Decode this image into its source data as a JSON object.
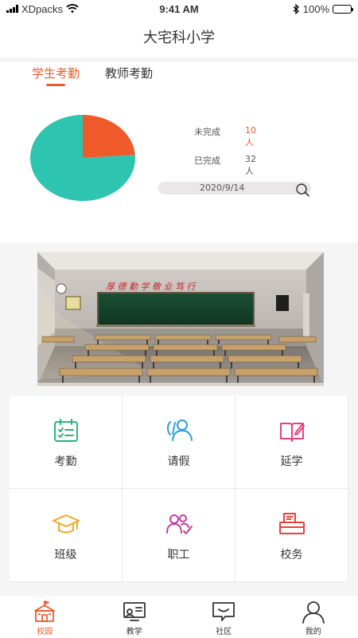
{
  "status_bar": {
    "carrier": "XDpacks",
    "time": "9:41 AM",
    "battery_text": "100%",
    "battery_level": 1.0
  },
  "header": {
    "title": "大宅科小学"
  },
  "attendance": {
    "tabs": [
      {
        "label": "学生考勤",
        "active": true
      },
      {
        "label": "教师考勤",
        "active": false
      }
    ],
    "stats": [
      {
        "label": "未完成",
        "value": "10人"
      },
      {
        "label": "已完成",
        "value": "32人"
      }
    ],
    "date": "2020/9/14",
    "colors": {
      "incomplete": "#ef5a2a",
      "complete": "#2dc4b0",
      "accent": "#ef5a2a"
    }
  },
  "chart_data": {
    "type": "pie",
    "labels": [
      "未完成",
      "已完成"
    ],
    "values": [
      10,
      32
    ],
    "colors": [
      "#ef5a2a",
      "#2dc4b0"
    ]
  },
  "menu": {
    "items": [
      {
        "label": "考勤",
        "icon": "attendance-icon",
        "color": "#2bb673"
      },
      {
        "label": "请假",
        "icon": "leave-icon",
        "color": "#2a9fd8"
      },
      {
        "label": "延学",
        "icon": "extended-study-icon",
        "color": "#e8417f"
      },
      {
        "label": "班级",
        "icon": "class-icon",
        "color": "#f5a623"
      },
      {
        "label": "职工",
        "icon": "staff-icon",
        "color": "#c63aa4"
      },
      {
        "label": "校务",
        "icon": "school-affairs-icon",
        "color": "#e8423a"
      }
    ]
  },
  "tabbar": {
    "items": [
      {
        "label": "校园",
        "icon": "campus-icon",
        "active": true
      },
      {
        "label": "教学",
        "icon": "teaching-icon",
        "active": false
      },
      {
        "label": "社区",
        "icon": "community-icon",
        "active": false
      },
      {
        "label": "我的",
        "icon": "profile-icon",
        "active": false
      }
    ]
  }
}
